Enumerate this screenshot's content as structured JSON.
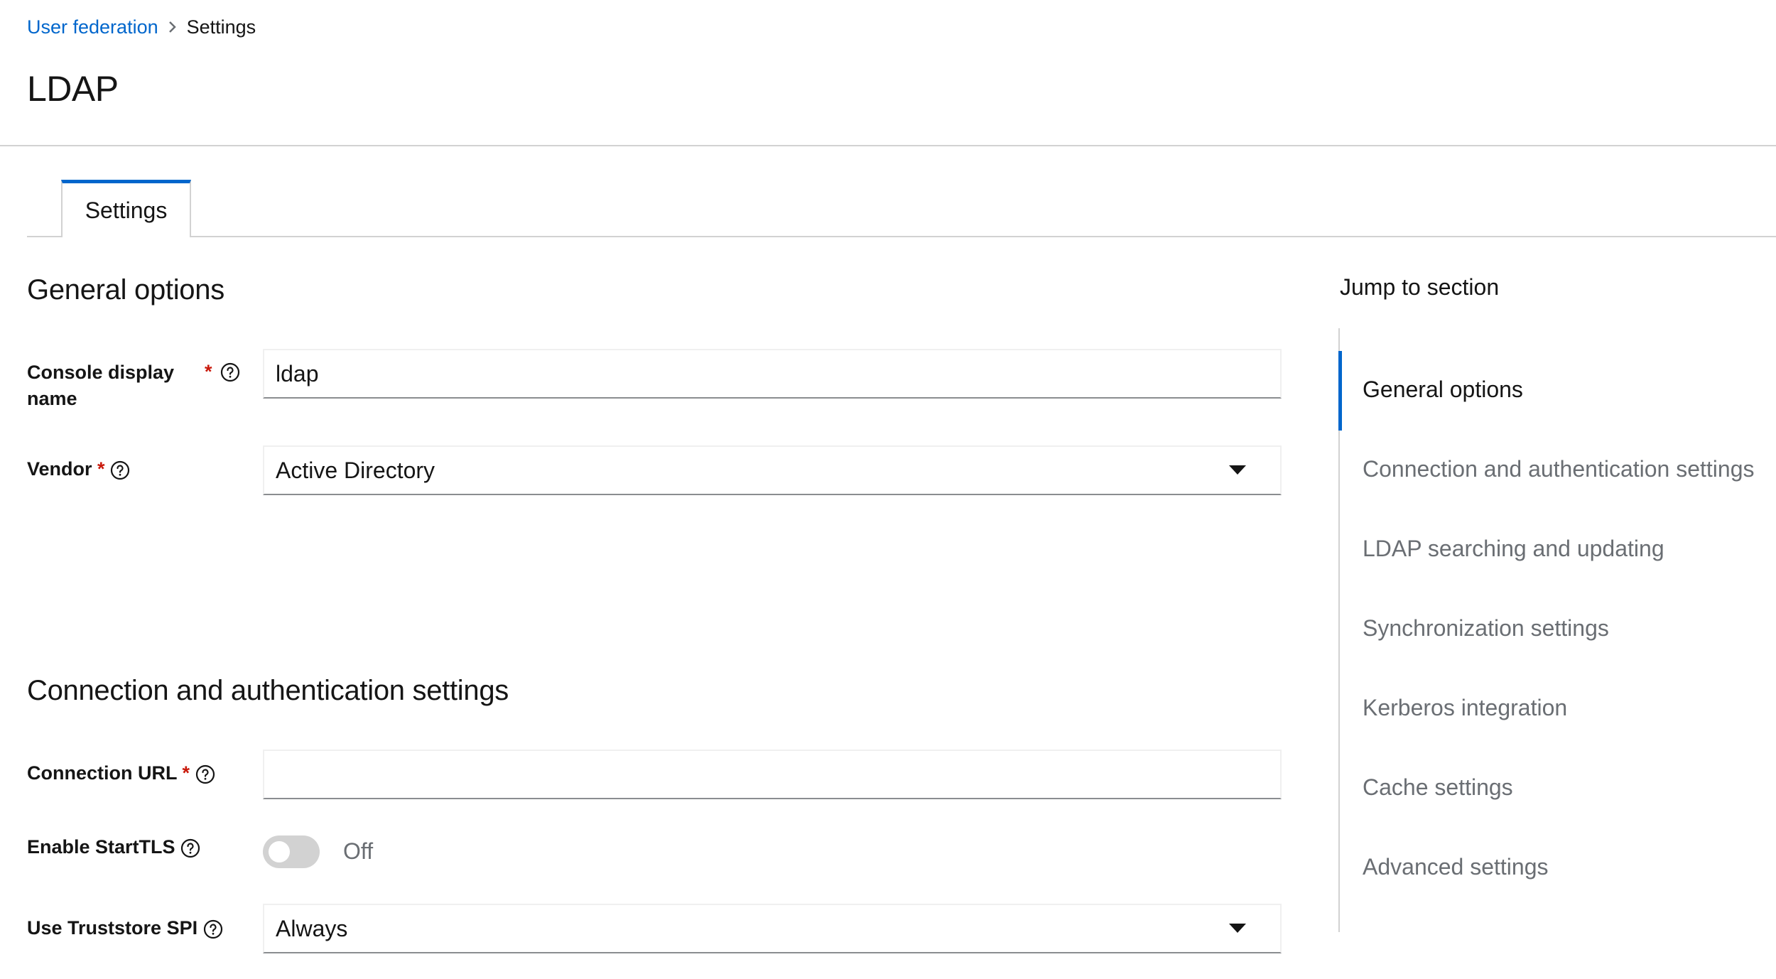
{
  "breadcrumb": {
    "parent_label": "User federation",
    "current_label": "Settings"
  },
  "page": {
    "title": "LDAP"
  },
  "tabs": [
    {
      "label": "Settings",
      "active": true
    }
  ],
  "general_options": {
    "title": "General options",
    "console_display_name": {
      "label_line1": "Console display",
      "label_line2": "name",
      "required_marker": "*",
      "value": "ldap"
    },
    "vendor": {
      "label": "Vendor",
      "required_marker": "*",
      "selected": "Active Directory"
    }
  },
  "connection_settings": {
    "title": "Connection and authentication settings",
    "connection_url": {
      "label": "Connection URL",
      "required_marker": "*",
      "value": ""
    },
    "enable_starttls": {
      "label": "Enable StartTLS",
      "state_label": "Off",
      "on": false
    },
    "use_truststore_spi": {
      "label": "Use Truststore SPI",
      "selected": "Always"
    }
  },
  "jump_to_section": {
    "title": "Jump to section",
    "items": [
      {
        "label": "General options",
        "active": true
      },
      {
        "label": "Connection and authentication settings",
        "active": false
      },
      {
        "label": "LDAP searching and updating",
        "active": false
      },
      {
        "label": "Synchronization settings",
        "active": false
      },
      {
        "label": "Kerberos integration",
        "active": false
      },
      {
        "label": "Cache settings",
        "active": false
      },
      {
        "label": "Advanced settings",
        "active": false
      }
    ]
  },
  "colors": {
    "link": "#0066cc",
    "required": "#c9190b",
    "muted_text": "#6a6e73",
    "divider": "#d2d2d2",
    "active_accent": "#0066cc"
  },
  "icons": {
    "breadcrumb_separator": "chevron-right-icon",
    "help": "help-circle-icon",
    "select_caret": "caret-down-icon"
  }
}
